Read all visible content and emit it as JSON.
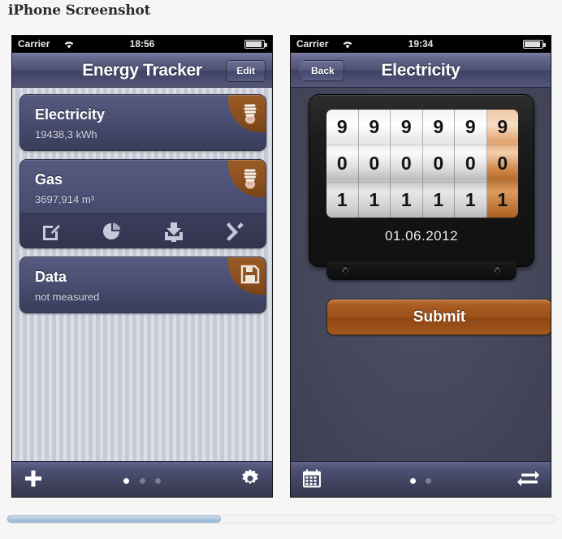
{
  "page": {
    "title": "iPhone Screenshot"
  },
  "phone1": {
    "status": {
      "carrier": "Carrier",
      "time": "18:56",
      "wifi_icon": "wifi-icon",
      "battery_icon": "battery-icon"
    },
    "nav": {
      "title": "Energy Tracker",
      "edit_label": "Edit"
    },
    "cards": [
      {
        "title": "Electricity",
        "value": "19438,3 kWh",
        "icon": "lightbulb-icon"
      },
      {
        "title": "Gas",
        "value": "3697,914 m³",
        "icon": "lightbulb-icon"
      },
      {
        "title": "Data",
        "value": "not measured",
        "icon": "floppy-disk-icon"
      }
    ],
    "card_toolbar": [
      {
        "icon": "edit-pencil-icon",
        "label": "Edit entry"
      },
      {
        "icon": "pie-chart-icon",
        "label": "Statistics"
      },
      {
        "icon": "download-icon",
        "label": "Export"
      },
      {
        "icon": "tools-icon",
        "label": "Settings"
      }
    ],
    "tabbar": {
      "left_icon": "plus-icon",
      "right_icon": "gear-icon",
      "dots": 3,
      "active_dot": 1
    }
  },
  "phone2": {
    "status": {
      "carrier": "Carrier",
      "time": "19:34",
      "wifi_icon": "wifi-icon",
      "battery_icon": "battery-icon"
    },
    "nav": {
      "title": "Electricity",
      "back_label": "Back"
    },
    "meter": {
      "columns": 6,
      "accent_column_index": 5,
      "rows": [
        [
          "9",
          "9",
          "9",
          "9",
          "9",
          "9"
        ],
        [
          "0",
          "0",
          "0",
          "0",
          "0",
          "0"
        ],
        [
          "1",
          "1",
          "1",
          "1",
          "1",
          "1"
        ]
      ],
      "selected_row_index": 1,
      "date": "01.06.2012",
      "accent_color": "#b5702f"
    },
    "submit_label": "Submit",
    "tabbar": {
      "left_icon": "calendar-icon",
      "right_icon": "swap-arrows-icon",
      "dots": 2,
      "active_dot": 1
    }
  },
  "scrollbar": {
    "thumb_fraction": 0.39,
    "orientation": "horizontal"
  }
}
